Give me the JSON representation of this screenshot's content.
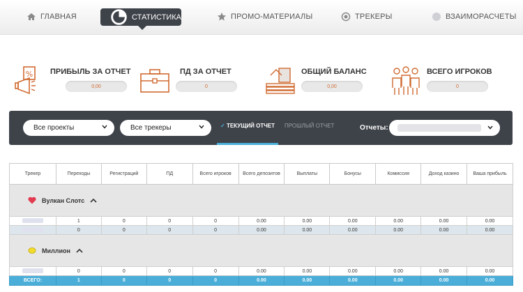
{
  "nav": {
    "items": [
      {
        "label": "ГЛАВНАЯ",
        "icon": "home-icon"
      },
      {
        "label": "СТАТИСТИКА",
        "icon": "pie-chart-icon"
      },
      {
        "label": "ПРОМО-МАТЕРИАЛЫ",
        "icon": "star-icon"
      },
      {
        "label": "ТРЕКЕРЫ",
        "icon": "target-icon"
      },
      {
        "label": "ВЗАИМОРАСЧЕТЫ",
        "icon": "coin-icon"
      }
    ],
    "active": "СТАТИСТИКА"
  },
  "stats": [
    {
      "title": "ПРИБЫЛЬ ЗА ОТЧЕТ",
      "value": "0,00",
      "icon": "percent-megaphone-icon"
    },
    {
      "title": "ПД ЗА ОТЧЕТ",
      "value": "0",
      "icon": "briefcase-icon"
    },
    {
      "title": "ОБЩИЙ БАЛАНС",
      "value": "0,00",
      "icon": "money-stack-icon"
    },
    {
      "title": "ВСЕГО ИГРОКОВ",
      "value": "0",
      "icon": "players-icon"
    }
  ],
  "filters": {
    "projects": "Все проекты",
    "trackers": "Все трекеры",
    "tab_current": "ТЕКУЩИЙ ОТЧЕТ",
    "tab_previous": "ПРОШЛЫЙ ОТЧЕТ",
    "reports_label": "Отчеты:"
  },
  "colors": {
    "accent": "#4aaed9",
    "dark": "#3e4249",
    "orange": "#d06a30"
  },
  "table": {
    "headers": [
      "Трекер",
      "Переходы",
      "Регистраций",
      "ПД",
      "Всего игроков",
      "Всего депозитов",
      "Выплаты",
      "Бонусы",
      "Комиссия",
      "Доход казино",
      "Ваша прибыль"
    ],
    "groups": [
      {
        "name": "Вулкан Слотс",
        "icon": "heart-icon",
        "rows": [
          [
            "1",
            "0",
            "0",
            "0",
            "0.00",
            "0.00",
            "0.00",
            "0.00",
            "0.00",
            "0.00"
          ],
          [
            "0",
            "0",
            "0",
            "0",
            "0.00",
            "0.00",
            "0.00",
            "0.00",
            "0.00",
            "0.00"
          ]
        ]
      },
      {
        "name": "Миллион",
        "icon": "lemon-icon",
        "rows": [
          [
            "0",
            "0",
            "0",
            "0",
            "0.00",
            "0.00",
            "0.00",
            "0.00",
            "0.00",
            "0.00"
          ]
        ]
      }
    ],
    "total": {
      "label": "ВСЕГО:",
      "values": [
        "1",
        "0",
        "0",
        "0",
        "0.00",
        "0.00",
        "0.00",
        "0.00",
        "0.00",
        "0.00"
      ]
    }
  }
}
